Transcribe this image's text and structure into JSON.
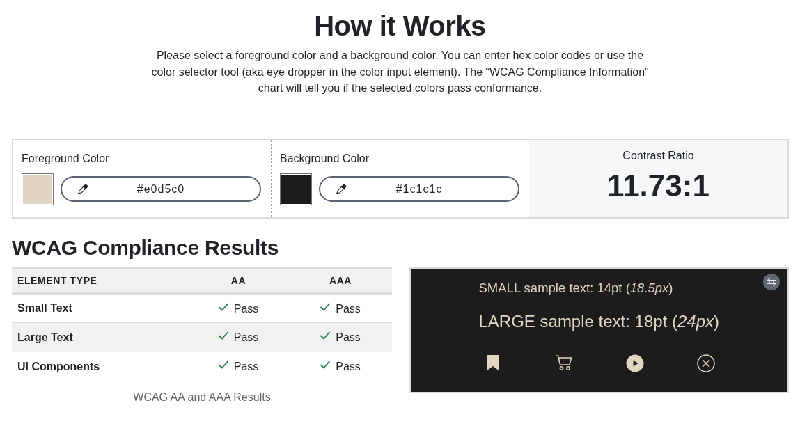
{
  "intro": {
    "title": "How it Works",
    "description": "Please select a foreground color and a background color. You can enter hex color codes or use the color selector tool (aka eye dropper in the color input element). The “WCAG Compliance Information” chart will tell you if the selected colors pass conformance."
  },
  "color_inputs": [
    {
      "label": "Foreground Color",
      "value": "#e0d5c0",
      "color": "#e0d5c0"
    },
    {
      "label": "Background Color",
      "value": "#1c1c1c",
      "color": "#1c1c1c"
    }
  ],
  "contrast": {
    "label": "Contrast Ratio",
    "value": "11.73:1"
  },
  "results": {
    "title": "WCAG Compliance Results",
    "columns": [
      "ELEMENT TYPE",
      "AA",
      "AAA"
    ],
    "rows": [
      {
        "element_type": "Small Text",
        "aa": {
          "result": "Pass",
          "passed": true
        },
        "aaa": {
          "result": "Pass",
          "passed": true
        }
      },
      {
        "element_type": "Large Text",
        "aa": {
          "result": "Pass",
          "passed": true
        },
        "aaa": {
          "result": "Pass",
          "passed": true
        }
      },
      {
        "element_type": "UI Components",
        "aa": {
          "result": "Pass",
          "passed": true
        },
        "aaa": {
          "result": "Pass",
          "passed": true
        }
      }
    ],
    "caption": "WCAG AA and AAA Results"
  },
  "sample": {
    "small_text": "SMALL sample text: 14pt (*18.5px*)",
    "large_text": "LARGE sample text: 18pt (*24px*)"
  }
}
